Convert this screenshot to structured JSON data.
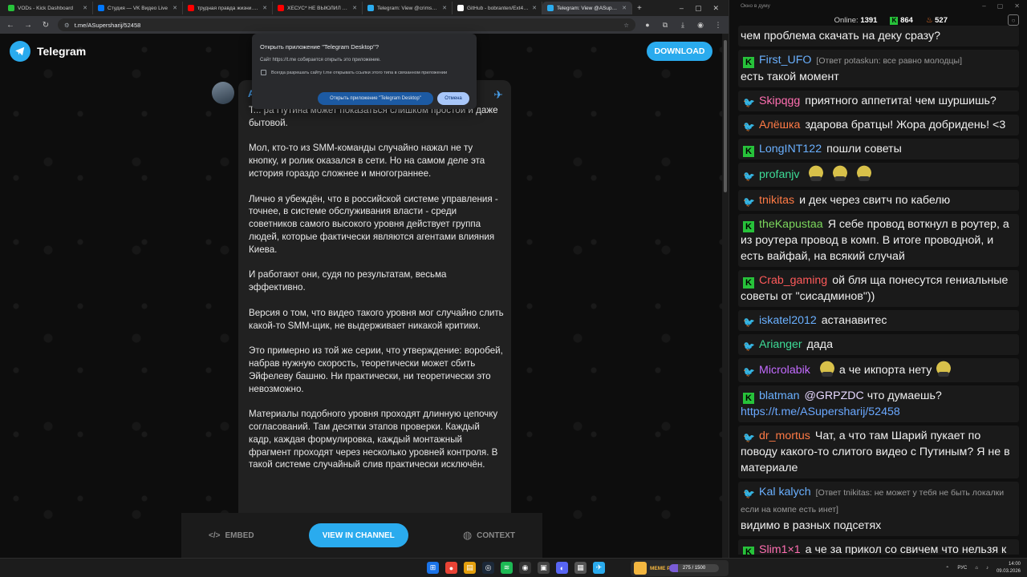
{
  "browser": {
    "tabs": [
      {
        "title": "VODs - Kick Dashboard",
        "color": "#27c23a"
      },
      {
        "title": "Студия — VK Видео Live",
        "color": "#0077ff"
      },
      {
        "title": "трудная правда жизни... - YouTube",
        "color": "#ff0000"
      },
      {
        "title": "ХЕСУС* НЕ ВЫЮЛИЛ ПОСТ...",
        "color": "#ff0000"
      },
      {
        "title": "Telegram: View @crimsondi...",
        "color": "#2aabee"
      },
      {
        "title": "GitHub - bobranten/Ext4Fsd",
        "color": "#ffffff"
      },
      {
        "title": "Telegram: View @ASupersha...",
        "color": "#2aabee"
      }
    ],
    "url": "t.me/ASupersharij/52458"
  },
  "telegram": {
    "brand": "Telegram",
    "download": "DOWNLOAD",
    "channel_initial": "А",
    "paragraphs": [
      "Т... ра Путина может показаться слишком простой и даже бытовой.",
      "Мол, кто-то из SMM-команды случайно нажал не ту кнопку, и ролик оказался в сети. Но на самом деле эта история гораздо сложнее и многограннее.",
      "Лично я убеждён, что в российской системе управления - точнее, в системе обслуживания власти - среди советников самого высокого уровня действует группа людей, которые фактически являются агентами влияния Киева.",
      "И работают они, судя по результатам, весьма эффективно.",
      "Версия о том, что видео такого уровня мог случайно слить какой-то SMM-щик, не выдерживает никакой критики.",
      "Это примерно из той же серии, что утверждение: воробей, набрав нужную скорость, теоретически может сбить Эйфелеву башню. Ни практически, ни теоретически это невозможно.",
      "Материалы подобного уровня проходят длинную цепочку согласований. Там десятки этапов проверки. Каждый кадр, каждая формулировка, каждый монтажный фрагмент проходят через несколько уровней контроля. В такой системе случайный слив практически исключён."
    ],
    "embed": "EMBED",
    "view": "VIEW IN CHANNEL",
    "context": "CONTEXT"
  },
  "dialog": {
    "title": "Открыть приложение \"Telegram Desktop\"?",
    "text": "Сайт https://t.me собирается открыть это приложение.",
    "checkbox": "Всегда разрешать сайту t.me открывать ссылки этого типа в связанном приложении",
    "open": "Открыть приложение \"Telegram Desktop\"",
    "cancel": "Отмена"
  },
  "chat": {
    "title": "Окно в думу",
    "online_label": "Online:",
    "online": "1391",
    "kick_count": "864",
    "fire_count": "527",
    "messages": [
      {
        "badge": "",
        "nick": "",
        "nick_color": "",
        "reply": "",
        "text": "чем проблема скачать на деку сразу?"
      },
      {
        "badge": "kick",
        "nick": "First_UFO",
        "nick_color": "#6ab0ff",
        "reply": "[Ответ potaskun: все равно молодцы]",
        "text": "есть такой момент"
      },
      {
        "badge": "bird",
        "nick": "Skipqgg",
        "nick_color": "#ff6fb1",
        "reply": "",
        "text": "приятного аппетита! чем шуршишь?"
      },
      {
        "badge": "bird",
        "nick": "Алёшка",
        "nick_color": "#ff7a45",
        "reply": "",
        "text": "здарова братцы! Жора добридень! <3"
      },
      {
        "badge": "kick",
        "nick": "LongINT122",
        "nick_color": "#6ab0ff",
        "reply": "",
        "text": "пошли советы"
      },
      {
        "badge": "bird",
        "nick": "profanjv",
        "nick_color": "#3ddc97",
        "reply": "",
        "text": "",
        "emotes": 3
      },
      {
        "badge": "bird",
        "nick": "tnikitas",
        "nick_color": "#ff7a45",
        "reply": "",
        "text": "и дек через свитч по кабелю"
      },
      {
        "badge": "kick",
        "nick": "theKapustaa",
        "nick_color": "#7bd65c",
        "reply": "",
        "text": "Я себе провод воткнул в роутер, а из роутера провод в комп. В итоге проводной, и есть вайфай, на всякий случай"
      },
      {
        "badge": "kick",
        "nick": "Crab_gaming",
        "nick_color": "#ff5a5a",
        "reply": "",
        "text": "ой бля ща понесутся гениальные советы от \"сисадминов\"))"
      },
      {
        "badge": "bird",
        "nick": "iskatel2012",
        "nick_color": "#6ab0ff",
        "reply": "",
        "text": "астанавитес"
      },
      {
        "badge": "bird",
        "nick": "Arianger",
        "nick_color": "#3ddc97",
        "reply": "",
        "text": "дада"
      },
      {
        "badge": "bird",
        "nick": "Microlabik",
        "nick_color": "#c36bff",
        "reply": "",
        "text": "а че икпорта нету",
        "emotes": 1
      },
      {
        "badge": "kick",
        "nick": "blatman",
        "nick_color": "#6ab0ff",
        "reply": "",
        "mention": "@GRPZDC",
        "text": "что думаешь?",
        "link": "https://t.me/ASupersharij/52458"
      },
      {
        "badge": "bird",
        "nick": "dr_mortus",
        "nick_color": "#ff7a45",
        "reply": "",
        "text": "Чат, а что там Шарий пукает по поводу какого-то слитого видео с Путиным? Я не в материале"
      },
      {
        "badge": "bird",
        "nick": "Kal kalych",
        "nick_color": "#6ab0ff",
        "reply": "[Ответ tnikitas: не может у тебя не быть локалки если на компе есть инет]",
        "text": "видимо в разных подсетях"
      },
      {
        "badge": "kick",
        "nick": "Slim1×1",
        "nick_color": "#ff6fb1",
        "reply": "",
        "text": "а че за прикол со свичем что нельзя к инету подключать, у меня пиратский свич есть, но таких приколюх там нет"
      }
    ]
  },
  "taskbar": {
    "meme_label": "MEME PARTY",
    "meme_progress": 0.18,
    "meme_count": "275 / 1500",
    "lang": "РУС",
    "time": "14:00",
    "date": "09.03.2026"
  }
}
